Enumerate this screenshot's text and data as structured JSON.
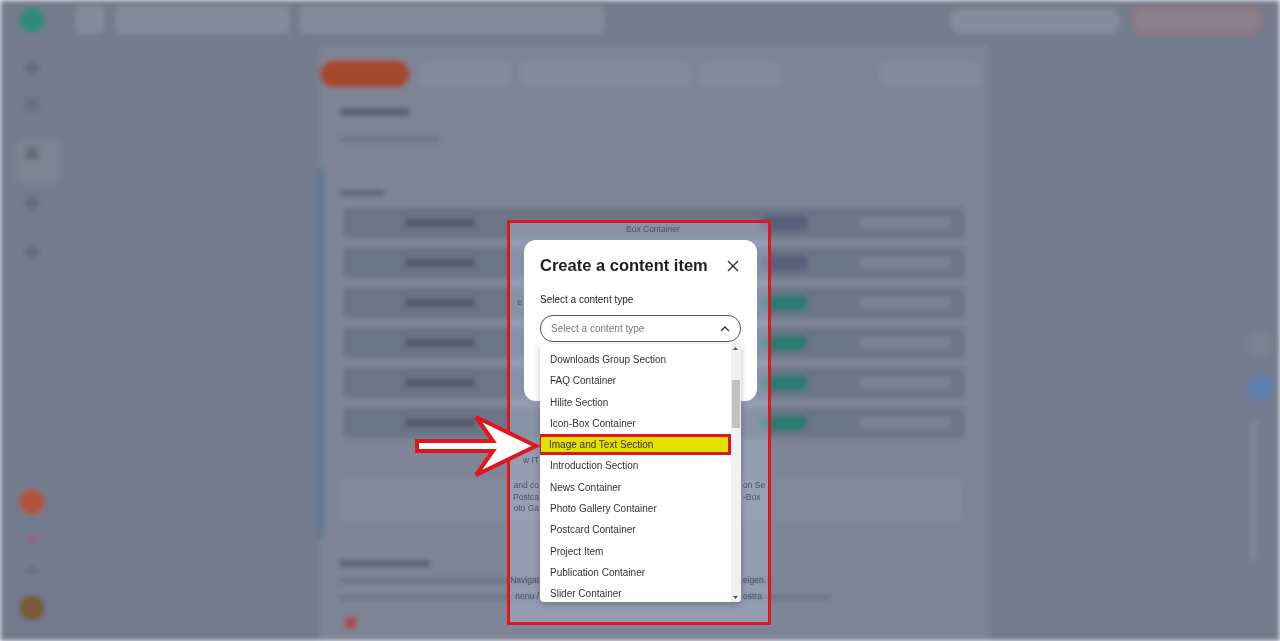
{
  "background_texts": [
    {
      "text": "Box Container"
    },
    {
      "text": "e"
    },
    {
      "text": "w IT"
    },
    {
      "text": "and co"
    },
    {
      "text": "Postca"
    },
    {
      "text": "oto Ga"
    },
    {
      "text": "on Se"
    },
    {
      "text": "-Box"
    },
    {
      "text": "Navigat"
    },
    {
      "text": "eigen."
    },
    {
      "text": "nenu /"
    },
    {
      "text": "ostra"
    }
  ],
  "dialog": {
    "title": "Create a content item",
    "field_label": "Select a content type",
    "select": {
      "placeholder": "Select a content type",
      "expanded": true
    },
    "options": [
      {
        "label": "Downloads Group Section",
        "selected": false
      },
      {
        "label": "FAQ Container",
        "selected": false
      },
      {
        "label": "Hilite Section",
        "selected": false
      },
      {
        "label": "Icon-Box Container",
        "selected": false
      },
      {
        "label": "Image and Text Section",
        "selected": true
      },
      {
        "label": "Introduction Section",
        "selected": false
      },
      {
        "label": "News Container",
        "selected": false
      },
      {
        "label": "Photo Gallery Container",
        "selected": false
      },
      {
        "label": "Postcard Container",
        "selected": false
      },
      {
        "label": "Project Item",
        "selected": false
      },
      {
        "label": "Publication Container",
        "selected": false
      },
      {
        "label": "Slider Container",
        "selected": false
      }
    ]
  }
}
